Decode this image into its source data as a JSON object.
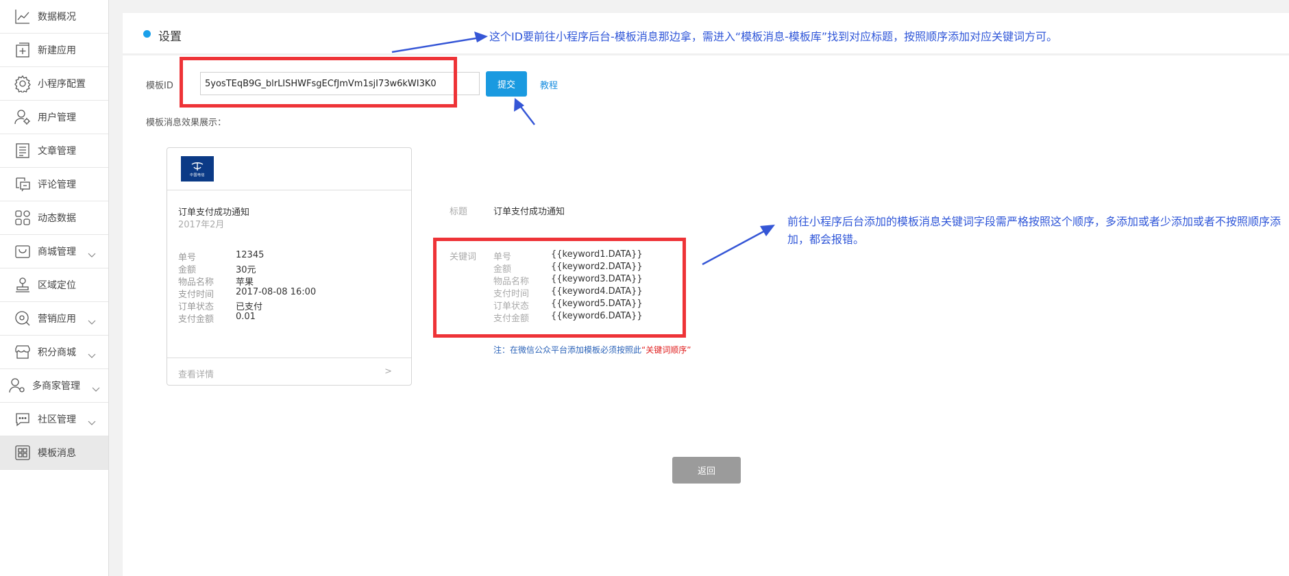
{
  "sidebar": {
    "items": [
      {
        "label": "数据概况",
        "icon": "line-chart-icon"
      },
      {
        "label": "新建应用",
        "icon": "add-app-icon"
      },
      {
        "label": "小程序配置",
        "icon": "gear-icon"
      },
      {
        "label": "用户管理",
        "icon": "user-settings-icon"
      },
      {
        "label": "文章管理",
        "icon": "article-icon"
      },
      {
        "label": "评论管理",
        "icon": "comment-icon"
      },
      {
        "label": "动态数据",
        "icon": "grid-icon"
      },
      {
        "label": "商城管理",
        "icon": "shop-icon"
      },
      {
        "label": "区域定位",
        "icon": "location-stamp-icon"
      },
      {
        "label": "营销应用",
        "icon": "marketing-icon"
      },
      {
        "label": "积分商城",
        "icon": "points-mall-icon"
      },
      {
        "label": "多商家管理",
        "icon": "multi-merchant-icon"
      },
      {
        "label": "社区管理",
        "icon": "community-icon"
      },
      {
        "label": "模板消息",
        "icon": "template-icon"
      }
    ],
    "active_index": 13
  },
  "header": {
    "title": "设置"
  },
  "annotations": {
    "top": "这个ID要前往小程序后台-模板消息那边拿，需进入“模板消息-模板库”找到对应标题，按照顺序添加对应关键词方可。",
    "right": "前往小程序后台添加的模板消息关键词字段需严格按照这个顺序，多添加或者少添加或者不按照顺序添加，都会报错。"
  },
  "form": {
    "id_label": "模板ID",
    "id_value": "5yosTEqB9G_blrLISHWFsgECfJmVm1sjI73w6kWI3K0",
    "submit_label": "提交",
    "tutorial_label": "教程",
    "preview_label": "模板消息效果展示："
  },
  "card": {
    "logo_text": "中国电信",
    "title": "订单支付成功通知",
    "date": "2017年2月",
    "rows": [
      {
        "k": "单号",
        "v": "12345"
      },
      {
        "k": "金额",
        "v": "30元"
      },
      {
        "k": "物品名称",
        "v": "苹果"
      },
      {
        "k": "支付时间",
        "v": "2017-08-08 16:00"
      },
      {
        "k": "订单状态",
        "v": "已支付"
      },
      {
        "k": "支付金额",
        "v": "0.01"
      }
    ],
    "detail_label": "查看详情",
    "detail_arrow": ">"
  },
  "info": {
    "title_label": "标题",
    "title_value": "订单支付成功通知",
    "keywords_label": "关键词",
    "keywords": [
      {
        "k": "单号",
        "v": "{{keyword1.DATA}}"
      },
      {
        "k": "金额",
        "v": "{{keyword2.DATA}}"
      },
      {
        "k": "物品名称",
        "v": "{{keyword3.DATA}}"
      },
      {
        "k": "支付时间",
        "v": "{{keyword4.DATA}}"
      },
      {
        "k": "订单状态",
        "v": "{{keyword5.DATA}}"
      },
      {
        "k": "支付金额",
        "v": "{{keyword6.DATA}}"
      }
    ],
    "remark_prefix": "注：在微信公众平台添加模板必须按照此",
    "remark_highlight": "“关键词顺序”"
  },
  "back_label": "返回",
  "colors": {
    "accent": "#1a9ae0",
    "annotation": "#2f56d8",
    "highlight_box": "#ee3337",
    "back_button": "#9b9b9b"
  }
}
